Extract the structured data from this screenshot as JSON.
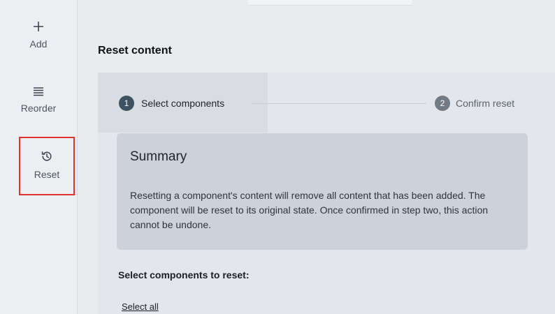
{
  "sidebar": {
    "items": [
      {
        "label": "Add",
        "icon": "plus-icon"
      },
      {
        "label": "Reorder",
        "icon": "list-icon"
      },
      {
        "label": "Reset",
        "icon": "history-icon",
        "highlight_color": "#e0332b"
      }
    ]
  },
  "page": {
    "title": "Reset content"
  },
  "stepper": {
    "steps": [
      {
        "number": "1",
        "label": "Select components",
        "active": true
      },
      {
        "number": "2",
        "label": "Confirm reset",
        "active": false
      }
    ]
  },
  "summary": {
    "title": "Summary",
    "text": "Resetting a component's content will remove all content that has been added. The component will be reset to its original state. Once confirmed in step two, this action cannot be undone."
  },
  "selection": {
    "label": "Select components to reset:",
    "select_all": "Select all"
  }
}
